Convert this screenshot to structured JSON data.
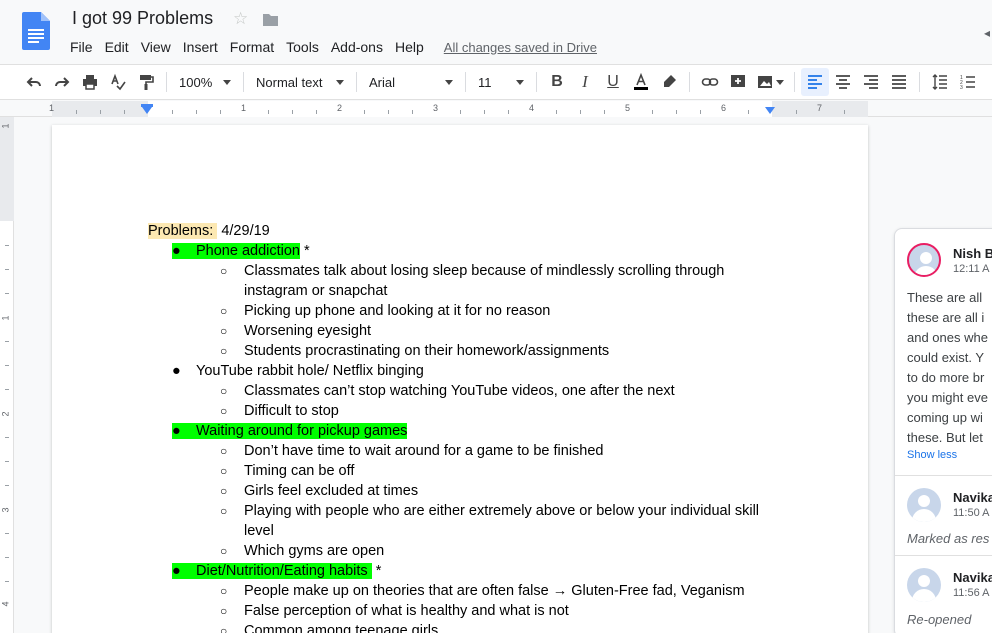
{
  "header": {
    "title": "I got 99 Problems",
    "menu": [
      "File",
      "Edit",
      "View",
      "Insert",
      "Format",
      "Tools",
      "Add-ons",
      "Help"
    ],
    "saved_status": "All changes saved in Drive"
  },
  "toolbar": {
    "zoom": "100%",
    "style": "Normal text",
    "font": "Arial",
    "size": "11"
  },
  "ruler": {
    "numbers": [
      "1",
      "1",
      "2",
      "3",
      "4",
      "5",
      "6",
      "7"
    ],
    "vertical_numbers": [
      "1",
      "1",
      "2",
      "3",
      "4"
    ]
  },
  "document": {
    "header_label": "Problems:",
    "header_date": "4/29/19",
    "sections": [
      {
        "title": "Phone addiction",
        "suffix": " *",
        "highlight": true,
        "items": [
          [
            "Classmates talk about losing sleep because of mindlessly scrolling through",
            "instagram or snapchat"
          ],
          [
            "Picking up phone and looking at it for no reason"
          ],
          [
            "Worsening eyesight"
          ],
          [
            "Students procrastinating on their homework/assignments"
          ]
        ]
      },
      {
        "title": "YouTube rabbit hole/ Netflix binging",
        "suffix": "",
        "highlight": false,
        "items": [
          [
            "Classmates can’t stop watching YouTube videos, one after the next"
          ],
          [
            "Difficult to stop"
          ]
        ]
      },
      {
        "title": "Waiting around for pickup games",
        "suffix": "",
        "highlight": true,
        "items": [
          [
            "Don’t have time to wait around for a game to be finished"
          ],
          [
            "Timing can be off"
          ],
          [
            "Girls feel excluded at times"
          ],
          [
            "Playing with people who are either extremely above or below your individual skill",
            "level"
          ],
          [
            "Which gyms are open"
          ]
        ]
      },
      {
        "title": "Diet/Nutrition/Eating habits ",
        "suffix": " *",
        "highlight": true,
        "items": [
          [
            "People make up on theories that are often false → Gluten-Free fad, Veganism"
          ],
          [
            "False perception of what is healthy and what is not"
          ],
          [
            "Common among teenage girls"
          ]
        ]
      }
    ]
  },
  "comments": {
    "first": {
      "name": "Nish B",
      "time": "12:11 A",
      "lines": [
        "These are all",
        "these are all i",
        "and ones whe",
        "could exist. Y",
        "to do more br",
        "you might eve",
        "coming up wi",
        "these. But let"
      ],
      "show_less": "Show less"
    },
    "second": {
      "name": "Navika",
      "time": "11:50 A",
      "status": "Marked as res"
    },
    "third": {
      "name": "Navika",
      "time": "11:56 A",
      "status": "Re-opened"
    }
  },
  "colors": {
    "highlight_green": "#00ff00",
    "highlight_yellow": "#fce8b2",
    "accent_blue": "#4285f4"
  }
}
